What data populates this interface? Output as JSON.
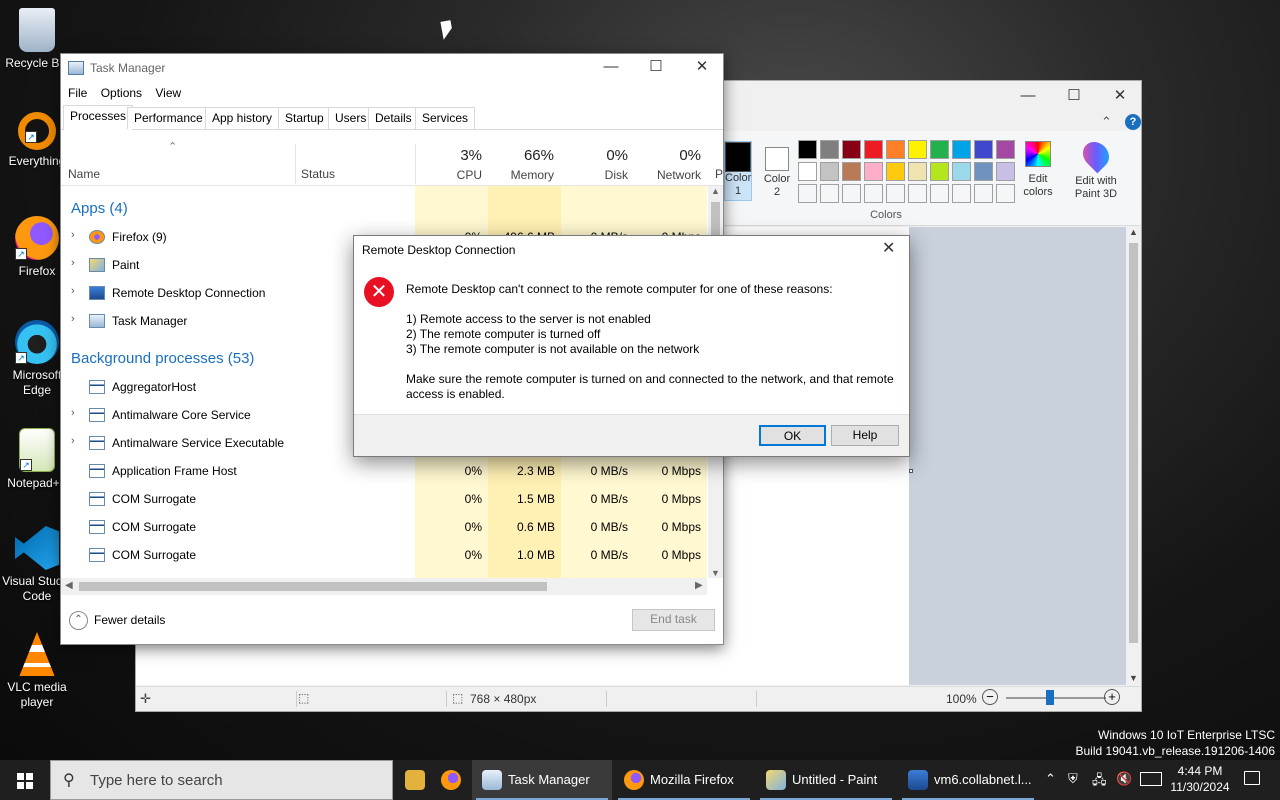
{
  "desktop": {
    "icons": [
      {
        "label": "Recycle Bin",
        "name": "recycle-bin-icon"
      },
      {
        "label": "Everything",
        "name": "everything-icon"
      },
      {
        "label": "Firefox",
        "name": "firefox-icon"
      },
      {
        "label": "Microsoft Edge",
        "name": "edge-icon"
      },
      {
        "label": "Notepad++",
        "name": "notepadpp-icon"
      },
      {
        "label": "Visual Studio Code",
        "name": "vscode-icon"
      },
      {
        "label": "VLC media player",
        "name": "vlc-icon"
      }
    ],
    "watermark": {
      "line1": "Windows 10 IoT Enterprise LTSC",
      "line2": "Build 19041.vb_release.191206-1406"
    }
  },
  "paint": {
    "color1_label": "Color 1",
    "color2_label": "Color 2",
    "edit_colors": "Edit colors",
    "edit_paint3d": "Edit with Paint 3D",
    "colors_group": "Colors",
    "palette": [
      "#000000",
      "#7f7f7f",
      "#880015",
      "#ed1c24",
      "#ff7f27",
      "#fff200",
      "#22b14c",
      "#00a2e8",
      "#3f48cc",
      "#a349a4",
      "#ffffff",
      "#c3c3c3",
      "#b97a57",
      "#ffaec9",
      "#ffc90e",
      "#efe4b0",
      "#b5e61d",
      "#99d9ea",
      "#7092be",
      "#c8bfe7"
    ],
    "status": {
      "size": "768 × 480px",
      "zoom": "100%"
    },
    "help_icon": "?"
  },
  "taskmanager": {
    "title": "Task Manager",
    "menu": [
      "File",
      "Options",
      "View"
    ],
    "tabs": [
      "Processes",
      "Performance",
      "App history",
      "Startup",
      "Users",
      "Details",
      "Services"
    ],
    "columns": {
      "name": "Name",
      "status": "Status",
      "cpu": {
        "pct": "3%",
        "label": "CPU"
      },
      "memory": {
        "pct": "66%",
        "label": "Memory"
      },
      "disk": {
        "pct": "0%",
        "label": "Disk"
      },
      "network": {
        "pct": "0%",
        "label": "Network"
      },
      "extra": "P"
    },
    "apps_group": "Apps (4)",
    "apps": [
      {
        "name": "Firefox (9)",
        "cpu": "0%",
        "mem": "496.6 MB",
        "disk": "0 MB/s",
        "net": "0 Mbps"
      },
      {
        "name": "Paint"
      },
      {
        "name": "Remote Desktop Connection"
      },
      {
        "name": "Task Manager"
      }
    ],
    "bg_group": "Background processes (53)",
    "bg": [
      {
        "name": "AggregatorHost"
      },
      {
        "name": "Antimalware Core Service"
      },
      {
        "name": "Antimalware Service Executable"
      },
      {
        "name": "Application Frame Host",
        "cpu": "0%",
        "mem": "2.3 MB",
        "disk": "0 MB/s",
        "net": "0 Mbps"
      },
      {
        "name": "COM Surrogate",
        "cpu": "0%",
        "mem": "1.5 MB",
        "disk": "0 MB/s",
        "net": "0 Mbps"
      },
      {
        "name": "COM Surrogate",
        "cpu": "0%",
        "mem": "0.6 MB",
        "disk": "0 MB/s",
        "net": "0 Mbps"
      },
      {
        "name": "COM Surrogate",
        "cpu": "0%",
        "mem": "1.0 MB",
        "disk": "0 MB/s",
        "net": "0 Mbps"
      }
    ],
    "fewer_details": "Fewer details",
    "end_task": "End task"
  },
  "dialog": {
    "title": "Remote Desktop Connection",
    "heading": "Remote Desktop can't connect to the remote computer for one of these reasons:",
    "reasons": [
      "1) Remote access to the server is not enabled",
      "2) The remote computer is turned off",
      "3) The remote computer is not available on the network"
    ],
    "advice": "Make sure the remote computer is turned on and connected to the network, and that remote access is enabled.",
    "ok": "OK",
    "help": "Help"
  },
  "taskbar": {
    "search_placeholder": "Type here to search",
    "apps": [
      "Task Manager",
      "Mozilla Firefox",
      "Untitled - Paint",
      "vm6.collabnet.l..."
    ],
    "time": "4:44 PM",
    "date": "11/30/2024"
  }
}
